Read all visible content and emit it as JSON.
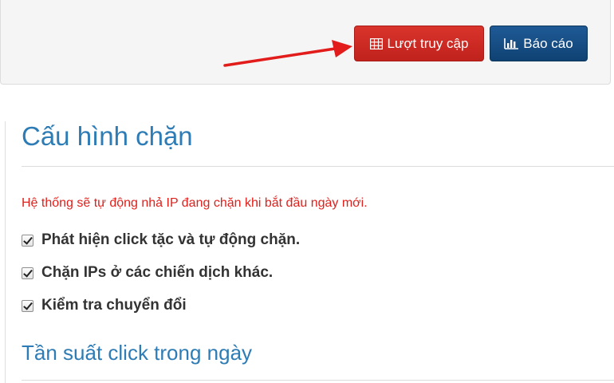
{
  "toolbar": {
    "visits_label": "Lượt truy cập",
    "visits_icon": "table-icon",
    "report_label": "Báo cáo",
    "report_icon": "bar-chart-icon"
  },
  "annotation": {
    "arrow_icon": "red-arrow-icon"
  },
  "section": {
    "title": "Cấu hình chặn",
    "notice": "Hệ thống sẽ tự động nhả IP đang chặn khi bắt đầu ngày mới.",
    "options": [
      {
        "label": "Phát hiện click tặc và tự động chặn.",
        "checked": true
      },
      {
        "label": "Chặn IPs ở các chiến dịch khác.",
        "checked": true
      },
      {
        "label": "Kiểm tra chuyển đổi",
        "checked": true
      }
    ]
  },
  "frequency": {
    "title": "Tần suất click trong ngày"
  },
  "colors": {
    "visits_button": "#c9271f",
    "report_button": "#0f4273",
    "title": "#2e7cb5",
    "notice": "#e0201b"
  }
}
